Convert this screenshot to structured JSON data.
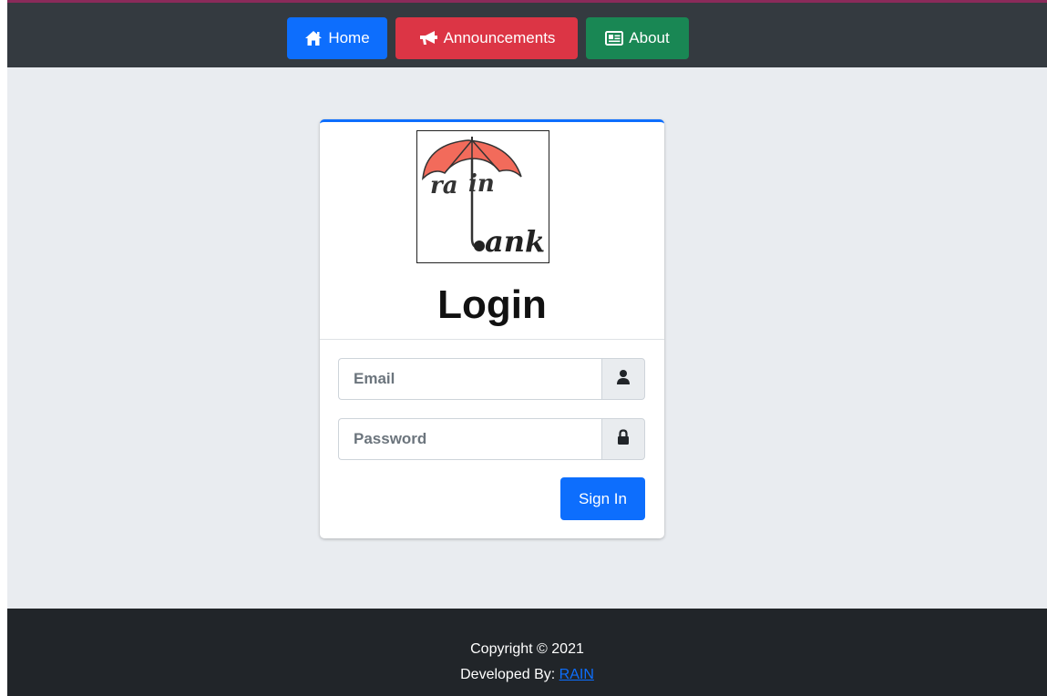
{
  "nav": {
    "home_label": "Home",
    "announcements_label": "Announcements",
    "about_label": "About"
  },
  "logo": {
    "text_top": "rain",
    "text_bottom": "bank"
  },
  "login": {
    "title": "Login",
    "email_placeholder": "Email",
    "password_placeholder": "Password",
    "signin_label": "Sign In"
  },
  "footer": {
    "copyright": "Copyright © 2021",
    "developed_by": "Developed By:",
    "developer_link": "RAIN"
  },
  "colors": {
    "primary": "#0d6efd",
    "danger": "#dc3545",
    "success": "#198754",
    "topbar": "#343a40",
    "footer": "#212529",
    "page_bg": "#e9ecf0",
    "umbrella": "#f26b5b"
  },
  "icons": {
    "home": "home-icon",
    "announcements": "megaphone-icon",
    "about": "id-card-icon",
    "email_addon": "user-icon",
    "password_addon": "lock-icon"
  }
}
